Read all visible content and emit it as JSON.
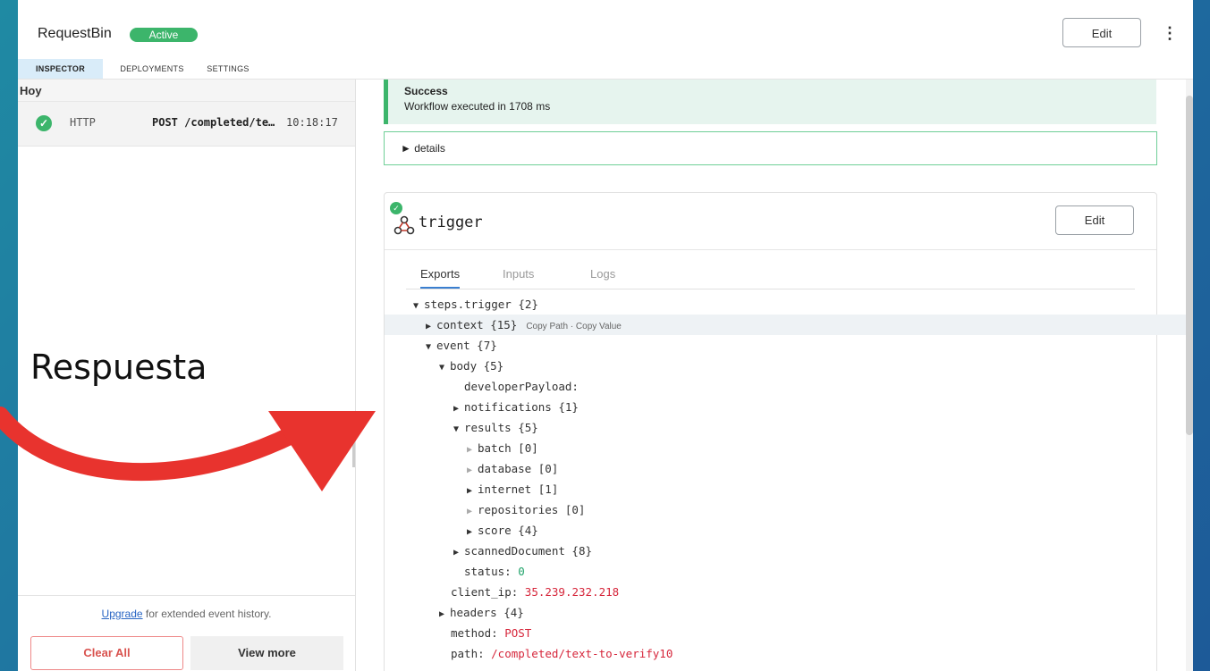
{
  "app": {
    "title": "RequestBin",
    "status_badge": "Active",
    "edit_label": "Edit",
    "more_icon": "⋮"
  },
  "tabs": [
    {
      "label": "INSPECTOR",
      "active": true
    },
    {
      "label": "DEPLOYMENTS",
      "active": false
    },
    {
      "label": "SETTINGS",
      "active": false
    }
  ],
  "sidebar": {
    "group_label": "Hoy",
    "events": [
      {
        "type": "HTTP",
        "path": "POST /completed/te…",
        "time": "10:18:17",
        "status": "success"
      }
    ],
    "upgrade_link": "Upgrade",
    "upgrade_text": " for extended event history.",
    "clear_all": "Clear All",
    "view_more": "View more"
  },
  "result": {
    "title": "Success",
    "message": "Workflow executed in 1708 ms",
    "details_label": "► details"
  },
  "step": {
    "name": "trigger",
    "edit_label": "Edit",
    "tabs": [
      "Exports",
      "Inputs",
      "Logs"
    ],
    "active_tab": "Exports",
    "copy_hint": "Copy Path · Copy Value",
    "tree": [
      {
        "key": "steps.trigger",
        "suffix": " {2}"
      },
      {
        "key": "context",
        "suffix": " {15}"
      },
      {
        "key": "event",
        "suffix": " {7}"
      },
      {
        "key": "body",
        "suffix": " {5}"
      },
      {
        "key": "developerPayload:",
        "suffix": ""
      },
      {
        "key": "notifications",
        "suffix": " {1}"
      },
      {
        "key": "results",
        "suffix": " {5}"
      },
      {
        "key": "batch",
        "suffix": " [0]"
      },
      {
        "key": "database",
        "suffix": " [0]"
      },
      {
        "key": "internet",
        "suffix": " [1]"
      },
      {
        "key": "repositories",
        "suffix": " [0]"
      },
      {
        "key": "score",
        "suffix": " {4}"
      },
      {
        "key": "scannedDocument",
        "suffix": " {8}"
      },
      {
        "key": "status: ",
        "value": "0"
      },
      {
        "key": "client_ip: ",
        "value": "35.239.232.218"
      },
      {
        "key": "headers",
        "suffix": " {4}"
      },
      {
        "key": "method: ",
        "value": "POST"
      },
      {
        "key": "path: ",
        "value": "/completed/text-to-verify10"
      }
    ]
  },
  "overlay": {
    "label": "Respuesta",
    "arrow_color": "#e8332e"
  }
}
